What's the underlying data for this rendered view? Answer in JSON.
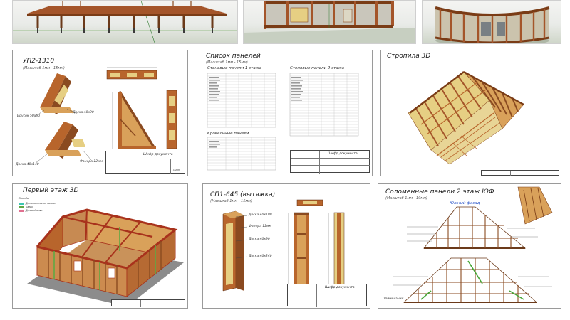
{
  "gallery": {
    "top_row": [
      {
        "name": "deck-frame-render"
      },
      {
        "name": "wall-frame-render"
      },
      {
        "name": "round-house-render"
      }
    ],
    "sheets": [
      {
        "title": "УП2-1310",
        "subtitle": "(Масштаб 1мм - 15мм)",
        "labels": [
          "Брусок 50х50",
          "Доска 40х90",
          "Доска 40х140",
          "Фанера 12мм"
        ],
        "titleblock": "Шифр документа",
        "sheet_name": "Лист"
      },
      {
        "title": "Список панелей",
        "subtitle": "(Масштаб 1мм - 15мм)",
        "heading_left": "Стеновые панели 1 этажа",
        "heading_right": "Стеновые панели 2 этажа",
        "heading_roof": "Кровельные панели",
        "titleblock": "Шифр документа"
      },
      {
        "title": "Стропила 3D"
      },
      {
        "title": "Первый этаж 3D",
        "legend_title": "Легенда",
        "legend": [
          {
            "label": "Дополнительные панели",
            "color": "#3cc6b2"
          },
          {
            "label": "Балки",
            "color": "#5fa844"
          },
          {
            "label": "Доска обвязки",
            "color": "#e07090"
          }
        ]
      },
      {
        "title": "СП1-645 (вытяжка)",
        "subtitle": "(Масштаб 1мм - 15мм)",
        "labels": [
          "Доска 40х190",
          "Фанера 12мм",
          "Доска 40х90",
          "Доска 40х240"
        ],
        "titleblock": "Шифр документа"
      },
      {
        "title": "Соломенные панели 2 этаж ЮФ",
        "subtitle": "(Масштаб 1мм - 10мм)",
        "facade_title": "Южный фасад",
        "notes_title": "Примечания"
      }
    ]
  },
  "colors": {
    "wood": "#b8652c",
    "wood_dark": "#7a3c16",
    "wood_light": "#d9a15a",
    "plywood": "#e6cf83",
    "frame_red": "#a8321c",
    "ground_grey": "#8c8c8c"
  }
}
